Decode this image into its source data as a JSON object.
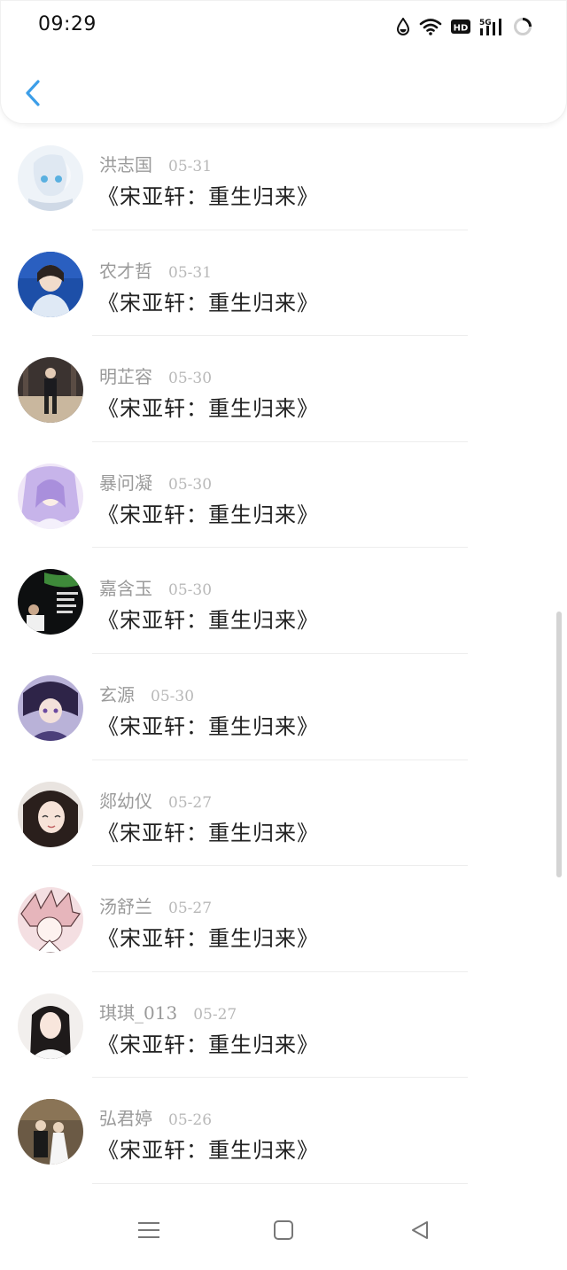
{
  "status_bar": {
    "time": "09:29",
    "icons": [
      "water-drop-icon",
      "wifi-icon",
      "hd-icon",
      "signal-5g-icon",
      "battery-loading-icon"
    ]
  },
  "header": {
    "back_icon": "chevron-left-icon",
    "accent_color": "#3c9ee8"
  },
  "items": [
    {
      "name": "洪志国",
      "date": "05-31",
      "title": "《宋亚轩：重生归来》"
    },
    {
      "name": "农才哲",
      "date": "05-31",
      "title": "《宋亚轩：重生归来》"
    },
    {
      "name": "明芷容",
      "date": "05-30",
      "title": "《宋亚轩：重生归来》"
    },
    {
      "name": "暴问凝",
      "date": "05-30",
      "title": "《宋亚轩：重生归来》"
    },
    {
      "name": "嘉含玉",
      "date": "05-30",
      "title": "《宋亚轩：重生归来》"
    },
    {
      "name": "玄源",
      "date": "05-30",
      "title": "《宋亚轩：重生归来》"
    },
    {
      "name": "郯幼仪",
      "date": "05-27",
      "title": "《宋亚轩：重生归来》"
    },
    {
      "name": "汤舒兰",
      "date": "05-27",
      "title": "《宋亚轩：重生归来》"
    },
    {
      "name": "琪琪_013",
      "date": "05-27",
      "title": "《宋亚轩：重生归来》"
    },
    {
      "name": "弘君婷",
      "date": "05-26",
      "title": "《宋亚轩：重生归来》"
    }
  ],
  "nav_bar": {
    "icons": [
      "menu-icon",
      "home-square-icon",
      "back-triangle-icon"
    ]
  }
}
